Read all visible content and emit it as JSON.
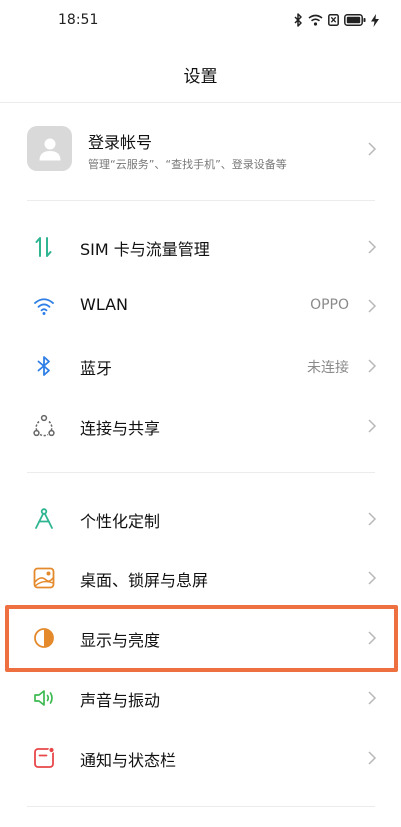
{
  "status_bar": {
    "time": "18:51",
    "icons": [
      "bluetooth-icon",
      "wifi-icon",
      "sim-icon",
      "battery-icon",
      "charging-icon"
    ]
  },
  "header": {
    "title": "设置"
  },
  "account": {
    "name": "登录帐号",
    "description": "管理“云服务”、“查找手机”、登录设备等",
    "icon": "avatar-person-icon"
  },
  "groups": [
    {
      "items": [
        {
          "id": "sim",
          "label": "SIM 卡与流量管理",
          "value": "",
          "icon": "sim-data-icon",
          "color": "#2fb592"
        },
        {
          "id": "wlan",
          "label": "WLAN",
          "value": "OPPO",
          "icon": "wifi-icon",
          "color": "#2f7fe6"
        },
        {
          "id": "bluetooth",
          "label": "蓝牙",
          "value": "未连接",
          "icon": "bluetooth-icon",
          "color": "#2f7fe6"
        },
        {
          "id": "connect",
          "label": "连接与共享",
          "value": "",
          "icon": "share-nodes-icon",
          "color": "#666666"
        }
      ]
    },
    {
      "items": [
        {
          "id": "personalize",
          "label": "个性化定制",
          "value": "",
          "icon": "compass-icon",
          "color": "#2fb592"
        },
        {
          "id": "wallpaper",
          "label": "桌面、锁屏与息屏",
          "value": "",
          "icon": "wallpaper-icon",
          "color": "#e58a2c"
        },
        {
          "id": "display",
          "label": "显示与亮度",
          "value": "",
          "icon": "brightness-icon",
          "color": "#e58a2c",
          "highlighted": true
        },
        {
          "id": "sound",
          "label": "声音与振动",
          "value": "",
          "icon": "speaker-icon",
          "color": "#3dba52"
        },
        {
          "id": "notification",
          "label": "通知与状态栏",
          "value": "",
          "icon": "notification-icon",
          "color": "#e8474a"
        }
      ]
    }
  ],
  "highlight_color": "#ee7040"
}
